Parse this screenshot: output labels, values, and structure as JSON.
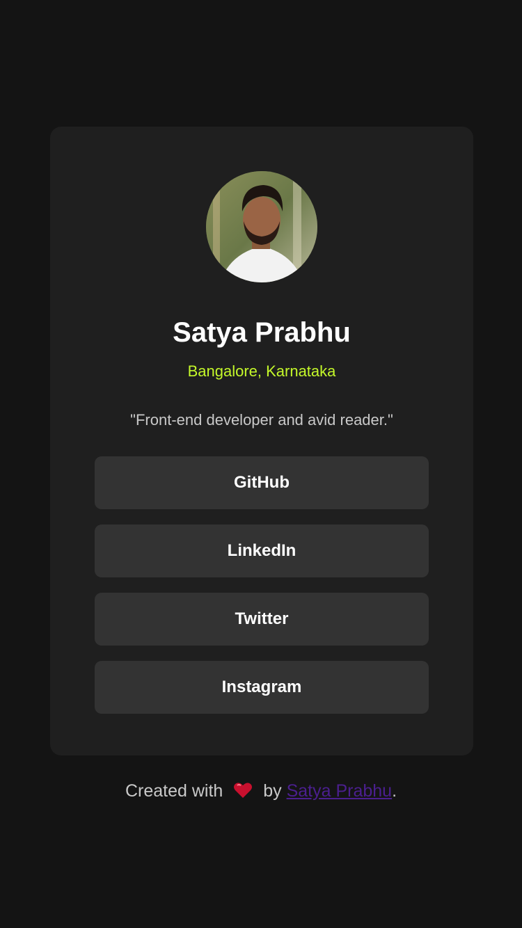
{
  "profile": {
    "name": "Satya Prabhu",
    "location": "Bangalore, Karnataka",
    "bio": "\"Front-end developer and avid reader.\""
  },
  "links": [
    {
      "label": "GitHub"
    },
    {
      "label": "LinkedIn"
    },
    {
      "label": "Twitter"
    },
    {
      "label": "Instagram"
    }
  ],
  "footer": {
    "prefix": "Created with",
    "by": "by",
    "author_link": "Satya Prabhu",
    "suffix": "."
  },
  "colors": {
    "background": "#141414",
    "card": "#1f1f1f",
    "button": "#333333",
    "accent_location": "#c4f82a",
    "link": "#4b1f8f"
  },
  "icons": {
    "heart": "heart-icon"
  }
}
